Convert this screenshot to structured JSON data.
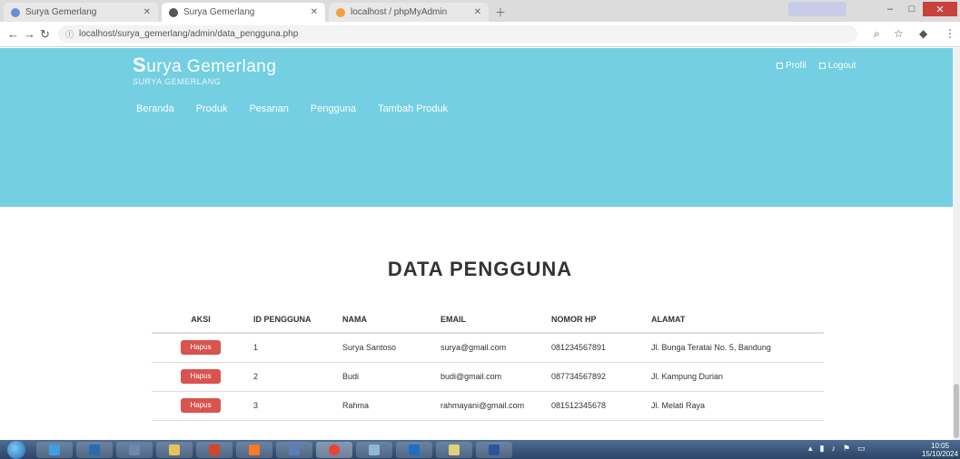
{
  "browser": {
    "tabs": [
      {
        "label": "Surya Gemerlang",
        "color": "#6a8fd6"
      },
      {
        "label": "Surya Gemerlang",
        "color": "#555555"
      },
      {
        "label": "localhost / phpMyAdmin",
        "color": "#f0a040"
      }
    ],
    "url": "localhost/surya_gemerlang/admin/data_pengguna.php"
  },
  "header": {
    "brand_initial": "S",
    "brand_rest": "urya Gemerlang",
    "brand_sub": "SURYA GEMERLANG",
    "user_links": [
      "Profil",
      "Logout"
    ],
    "nav": [
      "Beranda",
      "Produk",
      "Pesanan",
      "Pengguna",
      "Tambah Produk"
    ],
    "background": "#74cfe2"
  },
  "main": {
    "title": "DATA PENGGUNA",
    "columns": [
      "AKSI",
      "ID PENGGUNA",
      "NAMA",
      "EMAIL",
      "NOMOR HP",
      "ALAMAT"
    ],
    "button_label": "Hapus",
    "button_color": "#d9534f",
    "rows": [
      {
        "id": "1",
        "nama": "Surya Santoso",
        "email": "surya@gmail.com",
        "hp": "081234567891",
        "alamat": "Jl. Bunga Teratai No. 5, Bandung"
      },
      {
        "id": "2",
        "nama": "Budi",
        "email": "budi@gmail.com",
        "hp": "087734567892",
        "alamat": "Jl. Kampung Durian"
      },
      {
        "id": "3",
        "nama": "Rahma",
        "email": "rahmayani@gmail.com",
        "hp": "081512345678",
        "alamat": "Jl. Melati Raya"
      }
    ]
  },
  "taskbar": {
    "clock_time": "10:05",
    "clock_date": "15/10/2024"
  }
}
